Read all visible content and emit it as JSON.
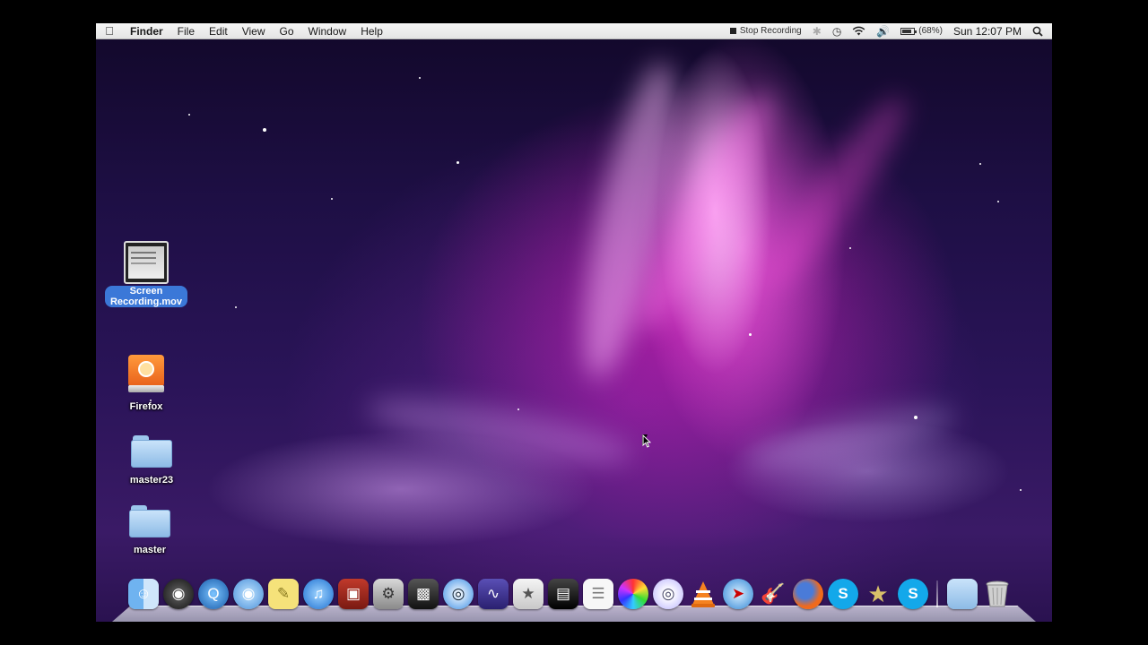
{
  "menubar": {
    "apple_icon": "apple-icon",
    "app_name": "Finder",
    "menus": [
      "File",
      "Edit",
      "View",
      "Go",
      "Window",
      "Help"
    ],
    "stop_recording": "Stop Recording",
    "battery_percent": "(68%)",
    "battery_level": 0.68,
    "clock": "Sun 12:07 PM",
    "status_icons": [
      "bluetooth-icon",
      "time-machine-icon",
      "wifi-icon",
      "volume-icon",
      "battery-icon",
      "spotlight-icon"
    ]
  },
  "desktop": {
    "icons": [
      {
        "label": "Screen Recording.mov",
        "line1": "Screen",
        "line2": "Recording.mov",
        "selected": true,
        "icon": "movie-thumbnail-icon"
      },
      {
        "label": "Firefox",
        "icon": "firefox-disk-icon"
      },
      {
        "label": "master23",
        "icon": "folder-icon"
      },
      {
        "label": "master",
        "icon": "folder-icon"
      }
    ]
  },
  "dock": {
    "apps": [
      "finder-icon",
      "dashboard-icon",
      "quicktime-icon",
      "facetime-icon",
      "stickies-icon",
      "itunes-icon",
      "photo-booth-icon",
      "system-preferences-icon",
      "final-cut-icon",
      "dvd-player-icon",
      "audio-app-icon",
      "preview-icon",
      "clapperboard-icon",
      "textedit-icon",
      "color-wheel-icon",
      "dvd-studio-icon",
      "vlc-icon",
      "safari-icon",
      "garageband-icon",
      "firefox-icon",
      "skype-icon",
      "imovie-icon",
      "skype-alt-icon"
    ],
    "right": [
      "downloads-folder-icon",
      "trash-icon"
    ]
  }
}
